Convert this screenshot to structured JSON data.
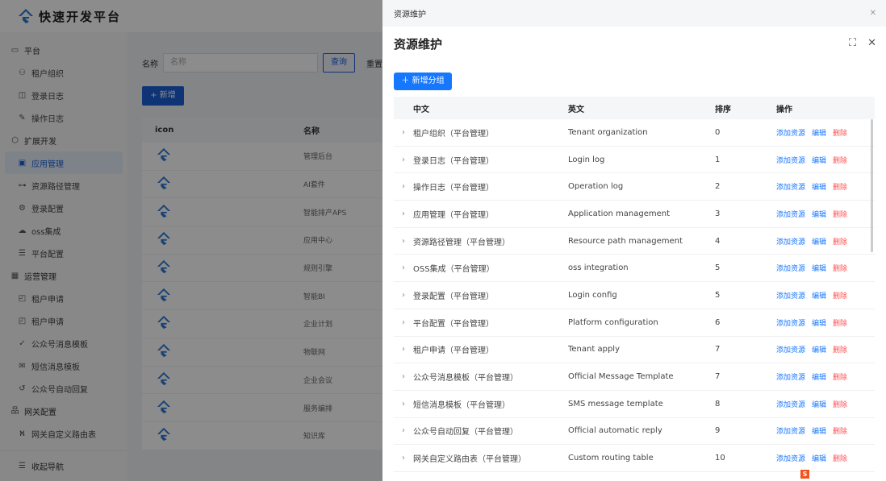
{
  "app": {
    "title": "快速开发平台"
  },
  "sidebar": {
    "groups": [
      {
        "label": "平台",
        "icon": "monitor-icon",
        "items": [
          {
            "label": "租户组织",
            "icon": "users-icon"
          },
          {
            "label": "登录日志",
            "icon": "log-icon"
          },
          {
            "label": "操作日志",
            "icon": "edit-log-icon"
          }
        ]
      },
      {
        "label": "扩展开发",
        "icon": "cube-icon",
        "items": [
          {
            "label": "应用管理",
            "icon": "terminal-icon",
            "active": true
          },
          {
            "label": "资源路径管理",
            "icon": "tree-icon"
          },
          {
            "label": "登录配置",
            "icon": "settings-icon"
          },
          {
            "label": "oss集成",
            "icon": "cloud-icon"
          },
          {
            "label": "平台配置",
            "icon": "config-icon"
          }
        ]
      },
      {
        "label": "运营管理",
        "icon": "dashboard-icon",
        "items": [
          {
            "label": "租户申请",
            "icon": "apply-icon"
          },
          {
            "label": "租户申请",
            "icon": "apply-icon"
          },
          {
            "label": "公众号消息模板",
            "icon": "check-badge-icon"
          },
          {
            "label": "短信消息模板",
            "icon": "message-icon"
          },
          {
            "label": "公众号自动回复",
            "icon": "reply-icon"
          }
        ]
      },
      {
        "label": "网关配置",
        "icon": "gateway-icon",
        "items": [
          {
            "label": "网关自定义路由表",
            "icon": "route-icon"
          }
        ]
      }
    ],
    "collapse_label": "收起导航"
  },
  "main": {
    "search_label": "名称",
    "search_placeholder": "名称",
    "query_button": "查询",
    "reset_button": "重置",
    "new_button": "新增",
    "columns": [
      "icon",
      "名称"
    ],
    "rows": [
      "管理后台",
      "AI套件",
      "智能排产APS",
      "应用中心",
      "规则引擎",
      "智能BI",
      "企业计划",
      "物联网",
      "企业会议",
      "服务编排",
      "知识库"
    ]
  },
  "drawer": {
    "tab_title": "资源维护",
    "title": "资源维护",
    "add_group_button": "新增分组",
    "columns": [
      "中文",
      "英文",
      "排序",
      "操作"
    ],
    "actions": {
      "add": "添加资源",
      "edit": "编辑",
      "delete": "删除"
    },
    "rows": [
      {
        "zh": "租户组织（平台管理）",
        "en": "Tenant organization",
        "sort": "0"
      },
      {
        "zh": "登录日志（平台管理）",
        "en": "Login log",
        "sort": "1"
      },
      {
        "zh": "操作日志（平台管理）",
        "en": "Operation log",
        "sort": "2"
      },
      {
        "zh": "应用管理（平台管理）",
        "en": "Application management",
        "sort": "3"
      },
      {
        "zh": "资源路径管理（平台管理）",
        "en": "Resource path management",
        "sort": "4"
      },
      {
        "zh": "OSS集成（平台管理）",
        "en": "oss integration",
        "sort": "5"
      },
      {
        "zh": "登录配置（平台管理）",
        "en": "Login config",
        "sort": "5"
      },
      {
        "zh": "平台配置（平台管理）",
        "en": "Platform configuration",
        "sort": "6"
      },
      {
        "zh": "租户申请（平台管理）",
        "en": "Tenant apply",
        "sort": "7"
      },
      {
        "zh": "公众号消息模板（平台管理）",
        "en": "Official Message Template",
        "sort": "7"
      },
      {
        "zh": "短信消息模板（平台管理）",
        "en": "SMS message template",
        "sort": "8"
      },
      {
        "zh": "公众号自动回复（平台管理）",
        "en": "Official automatic reply",
        "sort": "9"
      },
      {
        "zh": "网关自定义路由表（平台管理）",
        "en": "Custom routing table",
        "sort": "10"
      }
    ]
  },
  "colors": {
    "primary": "#1677ff",
    "danger": "#ff4d4f",
    "active_menu": "#1a5fd6"
  }
}
